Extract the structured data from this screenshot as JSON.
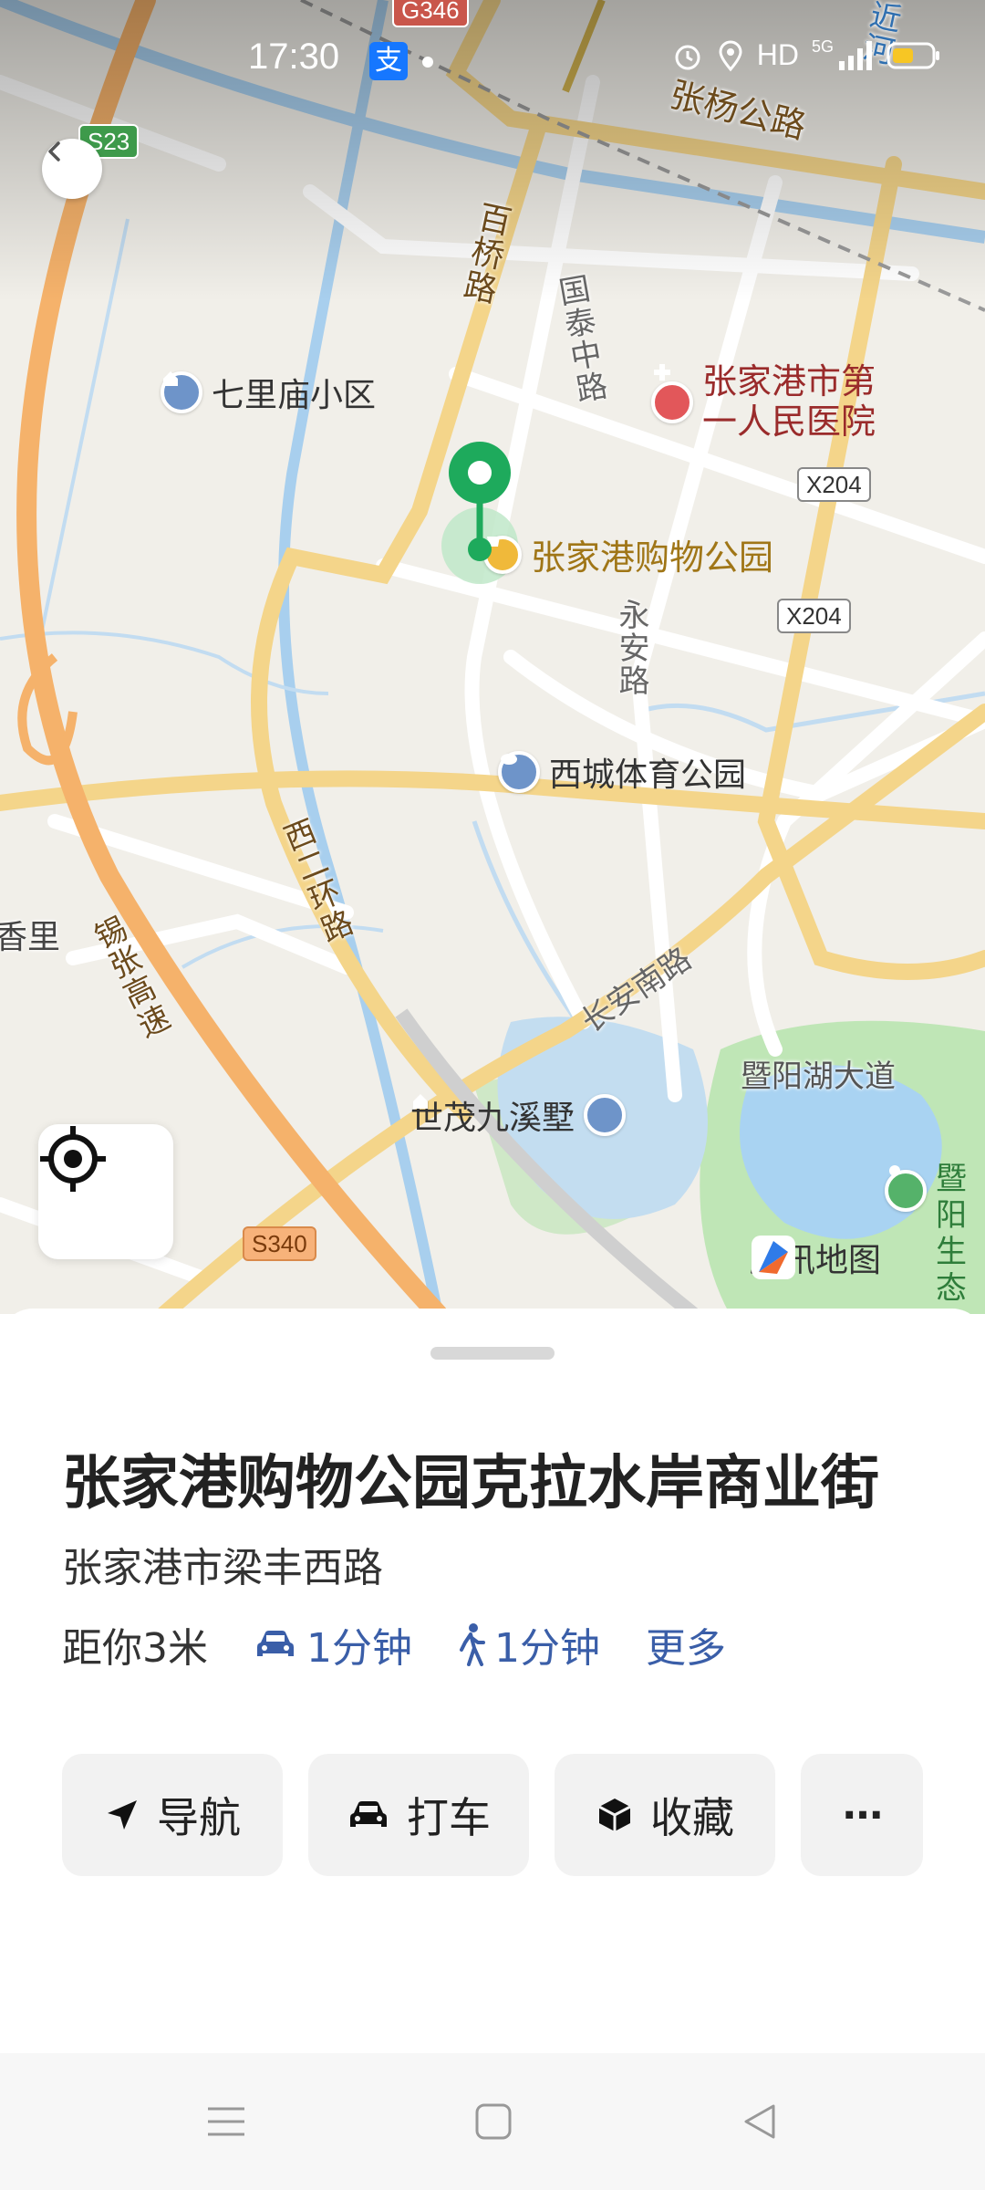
{
  "status_bar": {
    "time": "17:30",
    "app_icon": "支",
    "network": "HD",
    "signal": "5G"
  },
  "map": {
    "labels": {
      "G346": "G346",
      "S23": "S23",
      "S340": "S340",
      "X204_a": "X204",
      "X204_b": "X204",
      "zhangyang_rd": "张杨公路",
      "baiqiao_rd": "百桥路",
      "guotai_zhong_rd": "国泰中路",
      "yongan_rd": "永安路",
      "xierhuan_rd": "西二环路",
      "changan_nan_rd": "长安南路",
      "jingzhang_expy": "锡张高速",
      "jiyanghu_ave": "暨阳湖大道",
      "jin_he": "近河",
      "xiang_li": "香里",
      "qilimiao": "七里庙小区",
      "hospital": "张家港市第一人民医院",
      "shopping_park": "张家港购物公园",
      "xicheng_park": "西城体育公园",
      "shimao": "世茂九溪墅",
      "jiyang_right": "暨阳生态"
    },
    "brand": "腾讯地图"
  },
  "place": {
    "title": "张家港购物公园克拉水岸商业街",
    "address": "张家港市梁丰西路",
    "distance": "距你3米",
    "drive_time": "1分钟",
    "walk_time": "1分钟",
    "more": "更多"
  },
  "actions": {
    "navigate": "导航",
    "taxi": "打车",
    "favorite": "收藏",
    "more": "···"
  },
  "colors": {
    "accent_blue": "#3a5ea8",
    "pin_green": "#1eaa5c",
    "road_yellow": "#f4d58a",
    "expressway_orange": "#f5b26b",
    "water_blue": "#b9daf3",
    "park_green": "#bfe6b6"
  }
}
